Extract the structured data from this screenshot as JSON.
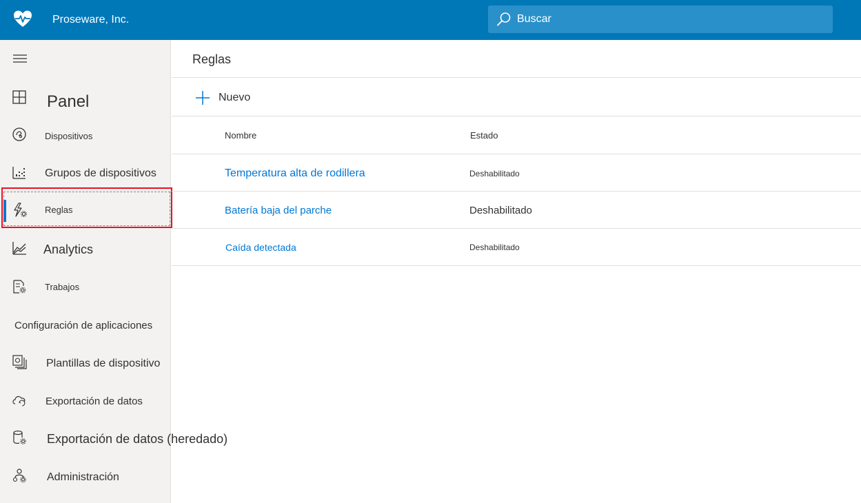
{
  "header": {
    "company": "Proseware, Inc.",
    "search_placeholder": "Buscar",
    "brand_color": "#0078b8"
  },
  "sidebar": {
    "items": [
      {
        "label": "Panel",
        "icon": "dashboard-icon"
      },
      {
        "label": "Dispositivos",
        "icon": "devices-icon"
      },
      {
        "label": "Grupos de dispositivos",
        "icon": "device-groups-icon"
      },
      {
        "label": "Reglas",
        "icon": "rules-icon",
        "active": true
      },
      {
        "label": "Analytics",
        "icon": "analytics-icon"
      },
      {
        "label": "Trabajos",
        "icon": "jobs-icon"
      }
    ],
    "section_header": "Configuración de aplicaciones",
    "config_items": [
      {
        "label": "Plantillas de dispositivo",
        "icon": "device-templates-icon"
      },
      {
        "label": "Exportación de datos",
        "icon": "data-export-icon"
      },
      {
        "label": "Exportación de datos (heredado)",
        "icon": "data-export-legacy-icon"
      },
      {
        "label": "Administración",
        "icon": "administration-icon"
      }
    ]
  },
  "main": {
    "title": "Reglas",
    "new_label": "Nuevo",
    "columns": [
      "Nombre",
      "Estado"
    ],
    "rows": [
      {
        "name": "Temperatura alta de rodillera",
        "state": "Deshabilitado"
      },
      {
        "name": "Batería baja del parche",
        "state": "Deshabilitado"
      },
      {
        "name": "Caída detectada",
        "state": "Deshabilitado"
      }
    ]
  }
}
